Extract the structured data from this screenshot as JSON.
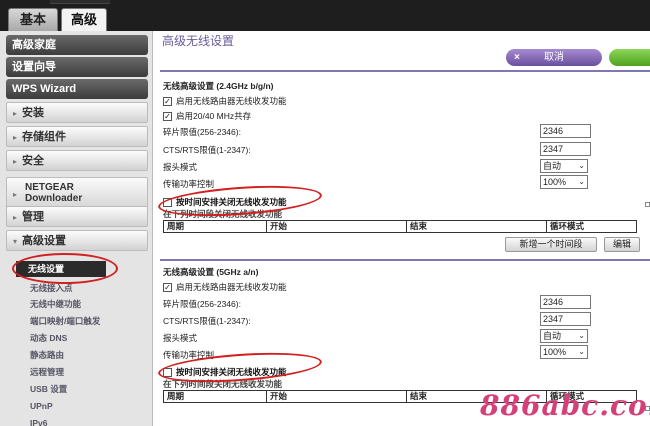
{
  "tabs": [
    {
      "label": "基本",
      "active": false
    },
    {
      "label": "高级",
      "active": true
    }
  ],
  "sidebar": {
    "dark_items": [
      {
        "label": "高级家庭"
      },
      {
        "label": "设置向导"
      },
      {
        "label": "WPS Wizard"
      }
    ],
    "light_items": [
      {
        "label": "安装",
        "arrow": "▸"
      },
      {
        "label": "存储组件",
        "arrow": "▸"
      },
      {
        "label": "安全",
        "arrow": "▸"
      },
      {
        "label": "管理",
        "arrow": "▸"
      },
      {
        "label": "高级设置",
        "arrow": "▾"
      }
    ],
    "netgear": {
      "line1": "NETGEAR",
      "line2": "Downloader",
      "arrow": "▸"
    },
    "sub_items": [
      {
        "label": "无线设置",
        "active": true
      },
      {
        "label": "无线接入点"
      },
      {
        "label": "无线中继功能"
      },
      {
        "label": "端口映射/端口触发"
      },
      {
        "label": "动态 DNS"
      },
      {
        "label": "静态路由"
      },
      {
        "label": "远程管理"
      },
      {
        "label": "USB 设置"
      },
      {
        "label": "UPnP"
      },
      {
        "label": "IPv6"
      }
    ]
  },
  "main": {
    "title": "高级无线设置",
    "cancel_label": "取消",
    "cancel_icon": "×",
    "apply_color": "#5cb82c",
    "sections": [
      {
        "title": "无线高级设置 (2.4GHz b/g/n)",
        "enable_radio": {
          "label": "启用无线路由器无线收发功能",
          "checked": true
        },
        "coexist": {
          "label": "启用20/40 MHz共存",
          "checked": true
        },
        "fragment": {
          "label": "碎片限值(256-2346):",
          "value": "2346"
        },
        "rts": {
          "label": "CTS/RTS限值(1-2347):",
          "value": "2347"
        },
        "preamble": {
          "label": "报头模式",
          "value": "自动"
        },
        "power": {
          "label": "传输功率控制",
          "value": "100%"
        },
        "schedule": {
          "label": "按时间安排关闭无线收发功能",
          "checked": false
        },
        "schedule_hint": "在下列时间段关闭无线收发功能",
        "table_headers": [
          "周期",
          "开始",
          "结束",
          "循环模式"
        ],
        "add_button": "新增一个时间段",
        "edit_button": "编辑"
      },
      {
        "title": "无线高级设置 (5GHz a/n)",
        "enable_radio": {
          "label": "启用无线路由器无线收发功能",
          "checked": true
        },
        "fragment": {
          "label": "碎片限值(256-2346):",
          "value": "2346"
        },
        "rts": {
          "label": "CTS/RTS限值(1-2347):",
          "value": "2347"
        },
        "preamble": {
          "label": "报头模式",
          "value": "自动"
        },
        "power": {
          "label": "传输功率控制",
          "value": "100%"
        },
        "schedule": {
          "label": "按时间安排关闭无线收发功能",
          "checked": false
        },
        "schedule_hint": "在下列时间段关闭无线收发功能",
        "table_headers": [
          "周期",
          "开始",
          "结束",
          "循环模式"
        ]
      }
    ]
  },
  "watermark": "886abc.com",
  "annotation_color": "#d22020"
}
